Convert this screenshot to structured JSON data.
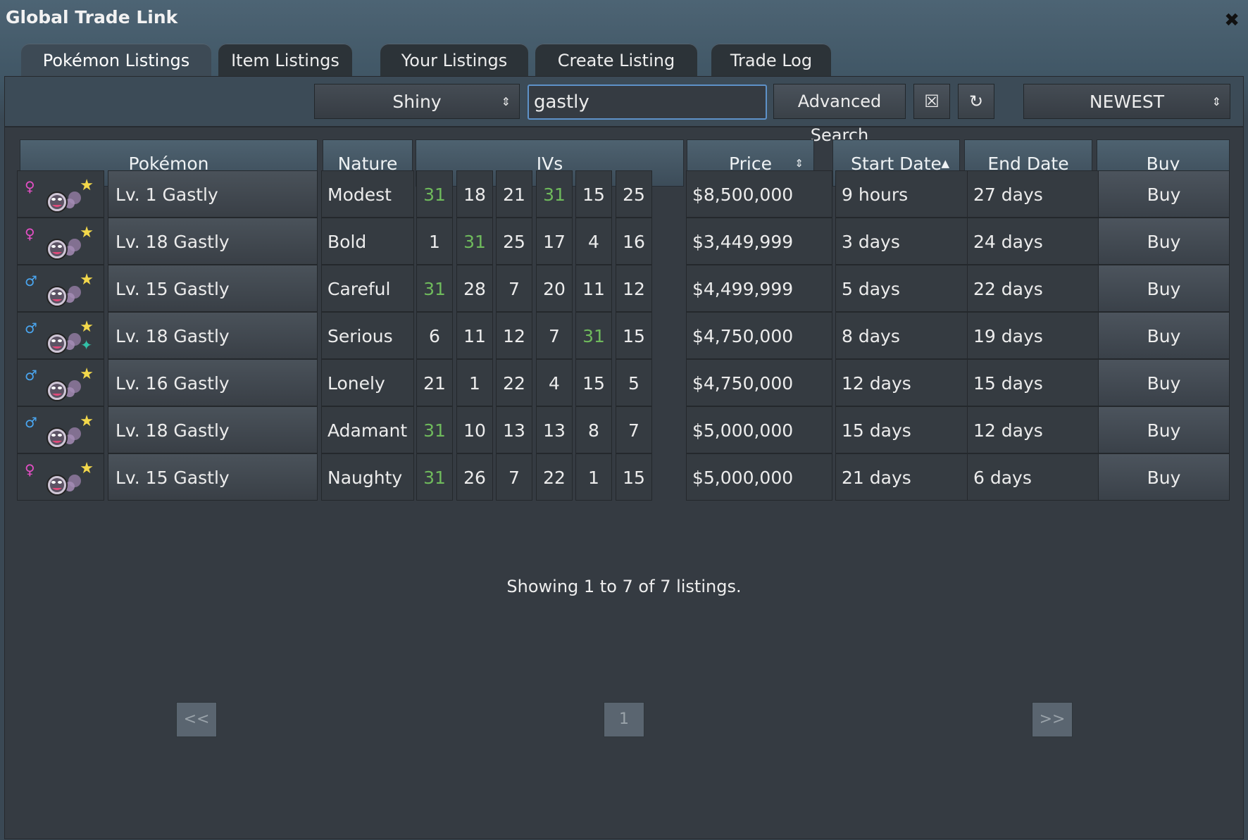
{
  "window": {
    "title": "Global Trade Link"
  },
  "tabs": [
    "Pokémon Listings",
    "Item Listings",
    "Your Listings",
    "Create Listing",
    "Trade Log"
  ],
  "toolbar": {
    "filter_value": "Shiny",
    "search_value": "gastly",
    "advanced_search_label": "Advanced Search",
    "clear_glyph": "☒",
    "refresh_glyph": "↻",
    "sort_value": "NEWEST"
  },
  "columns": {
    "pokemon": "Pokémon",
    "nature": "Nature",
    "ivs": "IVs",
    "price": "Price",
    "start_date": "Start Date",
    "end_date": "End Date",
    "buy": "Buy"
  },
  "sort_glyphs": {
    "updown": "⇕",
    "up": "▲"
  },
  "listings": [
    {
      "gender": "♀",
      "gender_color": "#e44fc5",
      "extra_sparkle": false,
      "name": "Lv. 1 Gastly",
      "nature": "Modest",
      "ivs": [
        31,
        18,
        21,
        31,
        15,
        25
      ],
      "price": "$8,500,000",
      "start": "9 hours",
      "end": "27 days",
      "buy": "Buy"
    },
    {
      "gender": "♀",
      "gender_color": "#e44fc5",
      "extra_sparkle": false,
      "name": "Lv. 18 Gastly",
      "nature": "Bold",
      "ivs": [
        1,
        31,
        25,
        17,
        4,
        16
      ],
      "price": "$3,449,999",
      "start": "3 days",
      "end": "24 days",
      "buy": "Buy"
    },
    {
      "gender": "♂",
      "gender_color": "#4aa6f0",
      "extra_sparkle": false,
      "name": "Lv. 15 Gastly",
      "nature": "Careful",
      "ivs": [
        31,
        28,
        7,
        20,
        11,
        12
      ],
      "price": "$4,499,999",
      "start": "5 days",
      "end": "22 days",
      "buy": "Buy"
    },
    {
      "gender": "♂",
      "gender_color": "#4aa6f0",
      "extra_sparkle": true,
      "name": "Lv. 18 Gastly",
      "nature": "Serious",
      "ivs": [
        6,
        11,
        12,
        7,
        31,
        15
      ],
      "price": "$4,750,000",
      "start": "8 days",
      "end": "19 days",
      "buy": "Buy"
    },
    {
      "gender": "♂",
      "gender_color": "#4aa6f0",
      "extra_sparkle": false,
      "name": "Lv. 16 Gastly",
      "nature": "Lonely",
      "ivs": [
        21,
        1,
        22,
        4,
        15,
        5
      ],
      "price": "$4,750,000",
      "start": "12 days",
      "end": "15 days",
      "buy": "Buy"
    },
    {
      "gender": "♂",
      "gender_color": "#4aa6f0",
      "extra_sparkle": false,
      "name": "Lv. 18 Gastly",
      "nature": "Adamant",
      "ivs": [
        31,
        10,
        13,
        13,
        8,
        7
      ],
      "price": "$5,000,000",
      "start": "15 days",
      "end": "12 days",
      "buy": "Buy"
    },
    {
      "gender": "♀",
      "gender_color": "#e44fc5",
      "extra_sparkle": false,
      "name": "Lv. 15 Gastly",
      "nature": "Naughty",
      "ivs": [
        31,
        26,
        7,
        22,
        1,
        15
      ],
      "price": "$5,000,000",
      "start": "21 days",
      "end": "6 days",
      "buy": "Buy"
    }
  ],
  "icons": {
    "star": "★",
    "sparkle": "✦",
    "close": "✖"
  },
  "colors": {
    "perfect_iv": "#6fba5c",
    "star": "#f3d84b",
    "sparkle": "#32c0a7",
    "search_focus": "#5e92c9"
  },
  "footer": {
    "showing": "Showing 1 to 7 of 7 listings.",
    "prev": "<<",
    "page": "1",
    "next": ">>"
  }
}
